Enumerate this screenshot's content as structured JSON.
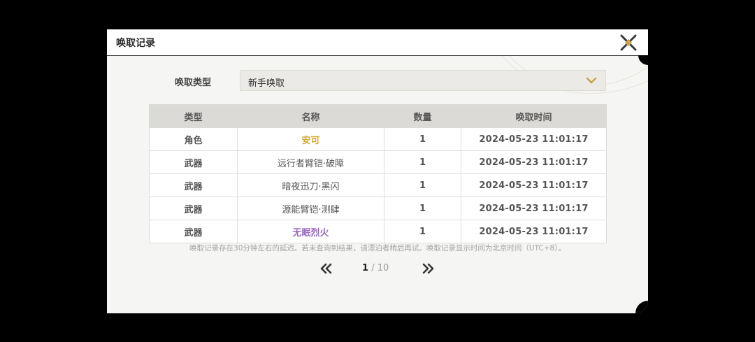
{
  "window": {
    "title": "唤取记录"
  },
  "filter": {
    "label": "唤取类型",
    "selected": "新手唤取"
  },
  "table": {
    "headers": [
      "类型",
      "名称",
      "数量",
      "唤取时间"
    ],
    "rows": [
      {
        "type": "角色",
        "name": "安可",
        "qty": "1",
        "time": "2024-05-23 11:01:17",
        "rarity": "gold"
      },
      {
        "type": "武器",
        "name": "远行者臂铠·破障",
        "qty": "1",
        "time": "2024-05-23 11:01:17",
        "rarity": "normal"
      },
      {
        "type": "武器",
        "name": "暗夜迅刀·黑闪",
        "qty": "1",
        "time": "2024-05-23 11:01:17",
        "rarity": "normal"
      },
      {
        "type": "武器",
        "name": "源能臂铠·测肆",
        "qty": "1",
        "time": "2024-05-23 11:01:17",
        "rarity": "normal"
      },
      {
        "type": "武器",
        "name": "无眠烈火",
        "qty": "1",
        "time": "2024-05-23 11:01:17",
        "rarity": "purple"
      }
    ]
  },
  "note": "唤取记录存在30分钟左右的延迟。若未查询到结果，请漂泊者稍后再试。唤取记录显示时间为北京时间（UTC+8）。",
  "pagination": {
    "current": "1",
    "separator": "/",
    "total": "10"
  },
  "icons": {
    "close": "close-icon",
    "dropdown": "chevron-down-icon",
    "prev": "double-chevron-left-icon",
    "next": "double-chevron-right-icon"
  },
  "colors": {
    "gold": "#d1ab2a",
    "purple": "#9a6abf",
    "accent": "#c9a24a"
  }
}
